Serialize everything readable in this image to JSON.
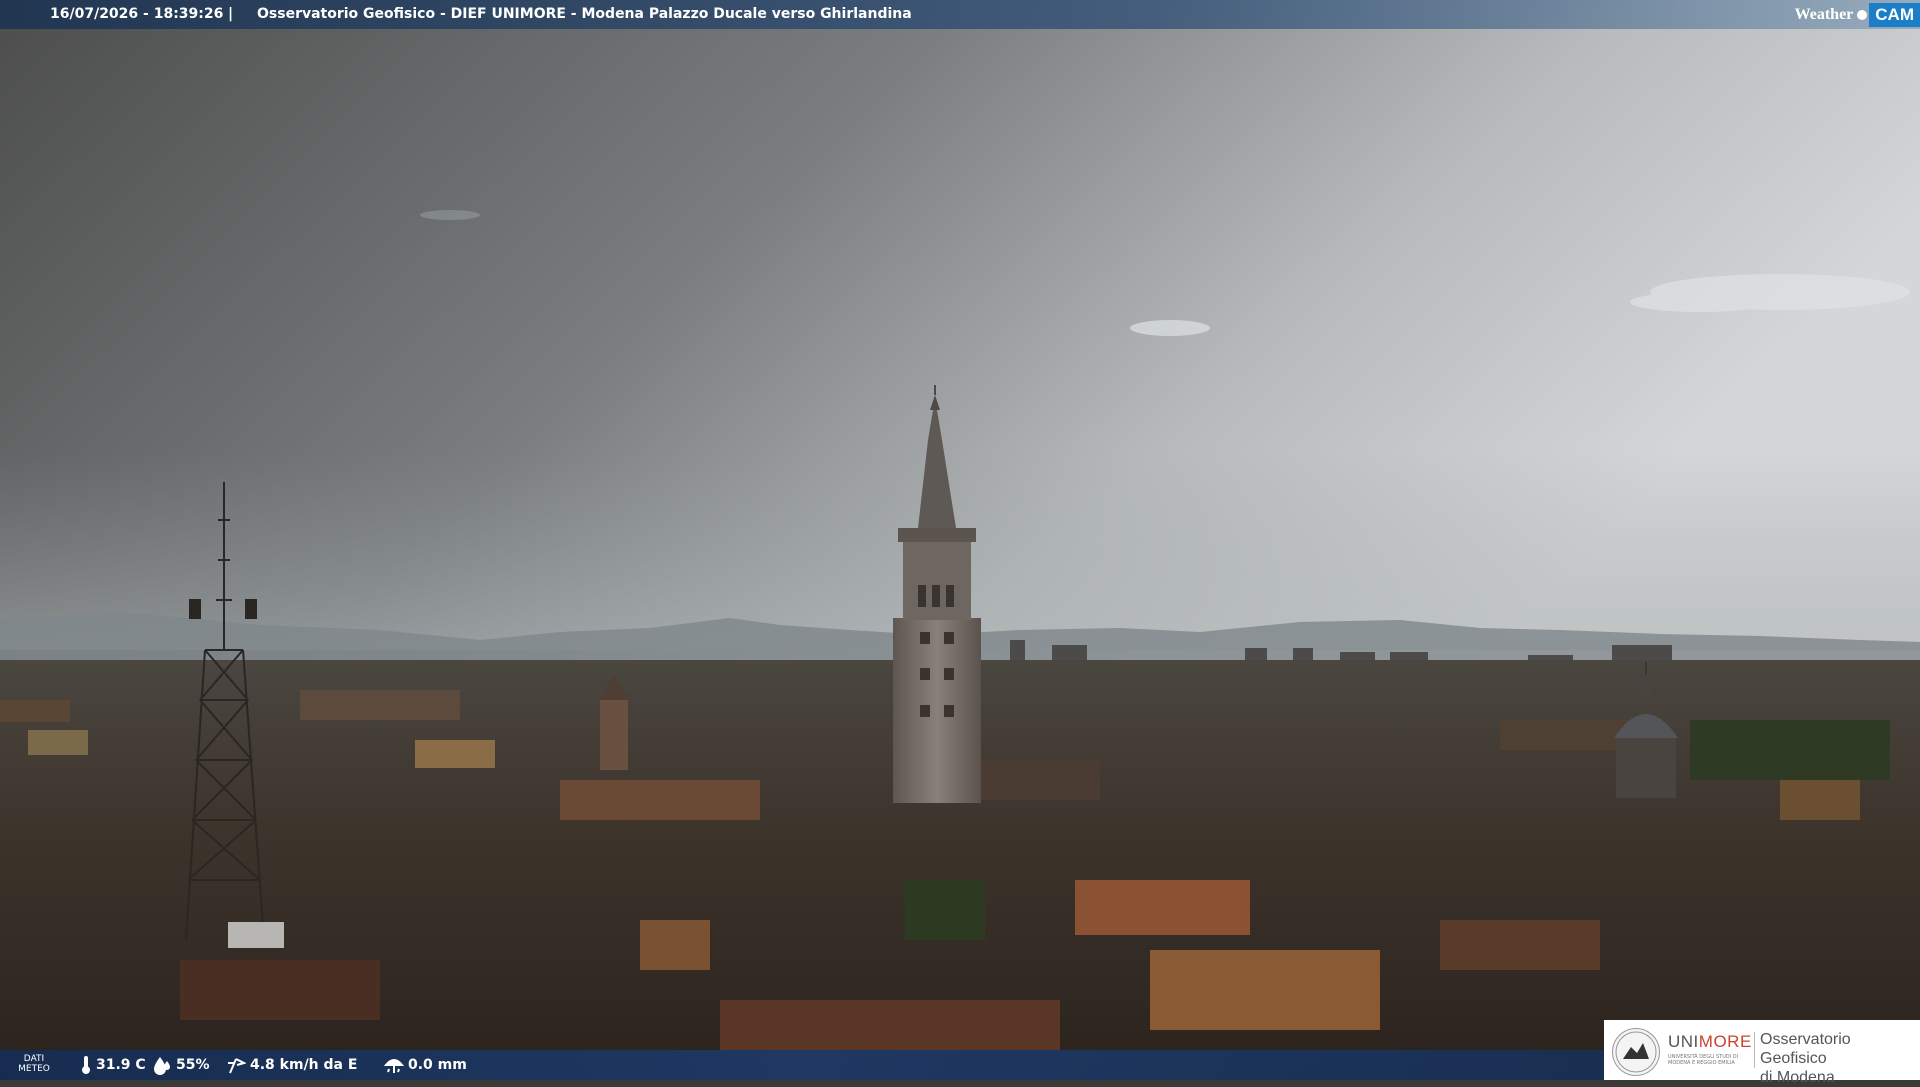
{
  "header": {
    "datetime": "16/07/2026 - 18:39:26",
    "separator": "|",
    "title": "Osservatorio Geofisico - DIEF UNIMORE - Modena Palazzo Ducale verso Ghirlandina",
    "brand_weather": "Weather",
    "brand_cam": "CAM"
  },
  "weather": {
    "label_line1": "DATI",
    "label_line2": "METEO",
    "temperature": "31.9 C",
    "humidity": "55%",
    "wind": "4.8 km/h da E",
    "rain": "0.0 mm",
    "icons": [
      "thermometer-icon",
      "humidity-drops-icon",
      "wind-vane-icon",
      "rain-gauge-icon"
    ]
  },
  "logo": {
    "uni": "UNI",
    "more": "MORE",
    "subtitle": "UNIVERSITÀ DEGLI STUDI DI MODENA E REGGIO EMILIA",
    "observatory_line1": "Osservatorio Geofisico",
    "observatory_line2": "di Modena"
  },
  "colors": {
    "header_bar": "#1e3452",
    "bottom_bar": "#142d55",
    "brand_blue": "#1a7fc8",
    "unimore_red": "#c8442e"
  }
}
